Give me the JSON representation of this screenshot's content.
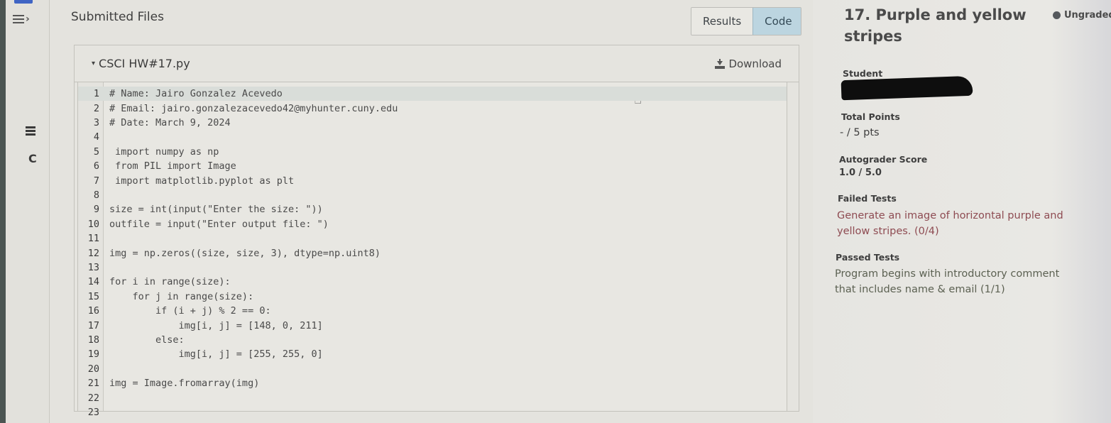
{
  "sidebar": {
    "menu_icon": "hamburger-chevron-icon",
    "list_icon": "list-icon",
    "reload_icon": "reload-icon",
    "reload_glyph": "C"
  },
  "header": {
    "title": "Submitted Files",
    "view_toggle": [
      {
        "label": "Results",
        "active": false
      },
      {
        "label": "Code",
        "active": true
      }
    ]
  },
  "file": {
    "caret": "▾",
    "name": "CSCI HW#17.py",
    "download_label": "Download",
    "lines": [
      {
        "n": "1",
        "text": "# Name: Jairo Gonzalez Acevedo"
      },
      {
        "n": "2",
        "text": "# Email: jairo.gonzalezacevedo42@myhunter.cuny.edu"
      },
      {
        "n": "3",
        "text": "# Date: March 9, 2024"
      },
      {
        "n": "4",
        "text": ""
      },
      {
        "n": "5",
        "text": " import numpy as np"
      },
      {
        "n": "6",
        "text": " from PIL import Image"
      },
      {
        "n": "7",
        "text": " import matplotlib.pyplot as plt"
      },
      {
        "n": "8",
        "text": ""
      },
      {
        "n": "9",
        "text": "size = int(input(\"Enter the size: \"))"
      },
      {
        "n": "10",
        "text": "outfile = input(\"Enter output file: \")"
      },
      {
        "n": "11",
        "text": ""
      },
      {
        "n": "12",
        "text": "img = np.zeros((size, size, 3), dtype=np.uint8)"
      },
      {
        "n": "13",
        "text": ""
      },
      {
        "n": "14",
        "text": "for i in range(size):"
      },
      {
        "n": "15",
        "text": "    for j in range(size):"
      },
      {
        "n": "16",
        "text": "        if (i + j) % 2 == 0:"
      },
      {
        "n": "17",
        "text": "            img[i, j] = [148, 0, 211]"
      },
      {
        "n": "18",
        "text": "        else:"
      },
      {
        "n": "19",
        "text": "            img[i, j] = [255, 255, 0]"
      },
      {
        "n": "20",
        "text": ""
      },
      {
        "n": "21",
        "text": "img = Image.fromarray(img)"
      },
      {
        "n": "22",
        "text": ""
      },
      {
        "n": "23",
        "text": ""
      }
    ]
  },
  "question": {
    "title": "17. Purple and yellow stripes",
    "status": "Ungraded",
    "student_label": "Student",
    "student_value": "[redacted]",
    "total_points_label": "Total Points",
    "total_points_value": "- / 5 pts",
    "autograder_label": "Autograder Score",
    "autograder_value": "1.0 / 5.0",
    "failed_label": "Failed Tests",
    "failed_tests": [
      "Generate an image of horizontal purple and yellow stripes. (0/4)"
    ],
    "passed_label": "Passed Tests",
    "passed_tests": [
      "Program begins with introductory comment that includes name & email (1/1)"
    ]
  },
  "colors": {
    "active_tab": "#bcd5e0",
    "failed_text": "#8e4b52",
    "passed_text": "#5c6152",
    "status_dot": "#55585c"
  }
}
